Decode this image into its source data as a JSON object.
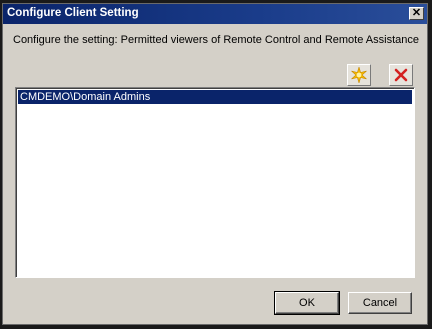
{
  "window": {
    "title": "Configure Client Setting",
    "close_glyph": "✕"
  },
  "instruction": "Configure the setting: Permitted viewers of Remote Control and Remote Assistance",
  "toolbar": {
    "new_icon": "starburst-new-icon",
    "delete_icon": "red-x-delete-icon",
    "accent_new": "#f5b800",
    "accent_delete": "#d42020"
  },
  "list": {
    "items": [
      {
        "label": "CMDEMO\\Domain Admins",
        "selected": true
      }
    ],
    "selection_color": "#0a246a"
  },
  "buttons": {
    "ok": "OK",
    "cancel": "Cancel"
  }
}
